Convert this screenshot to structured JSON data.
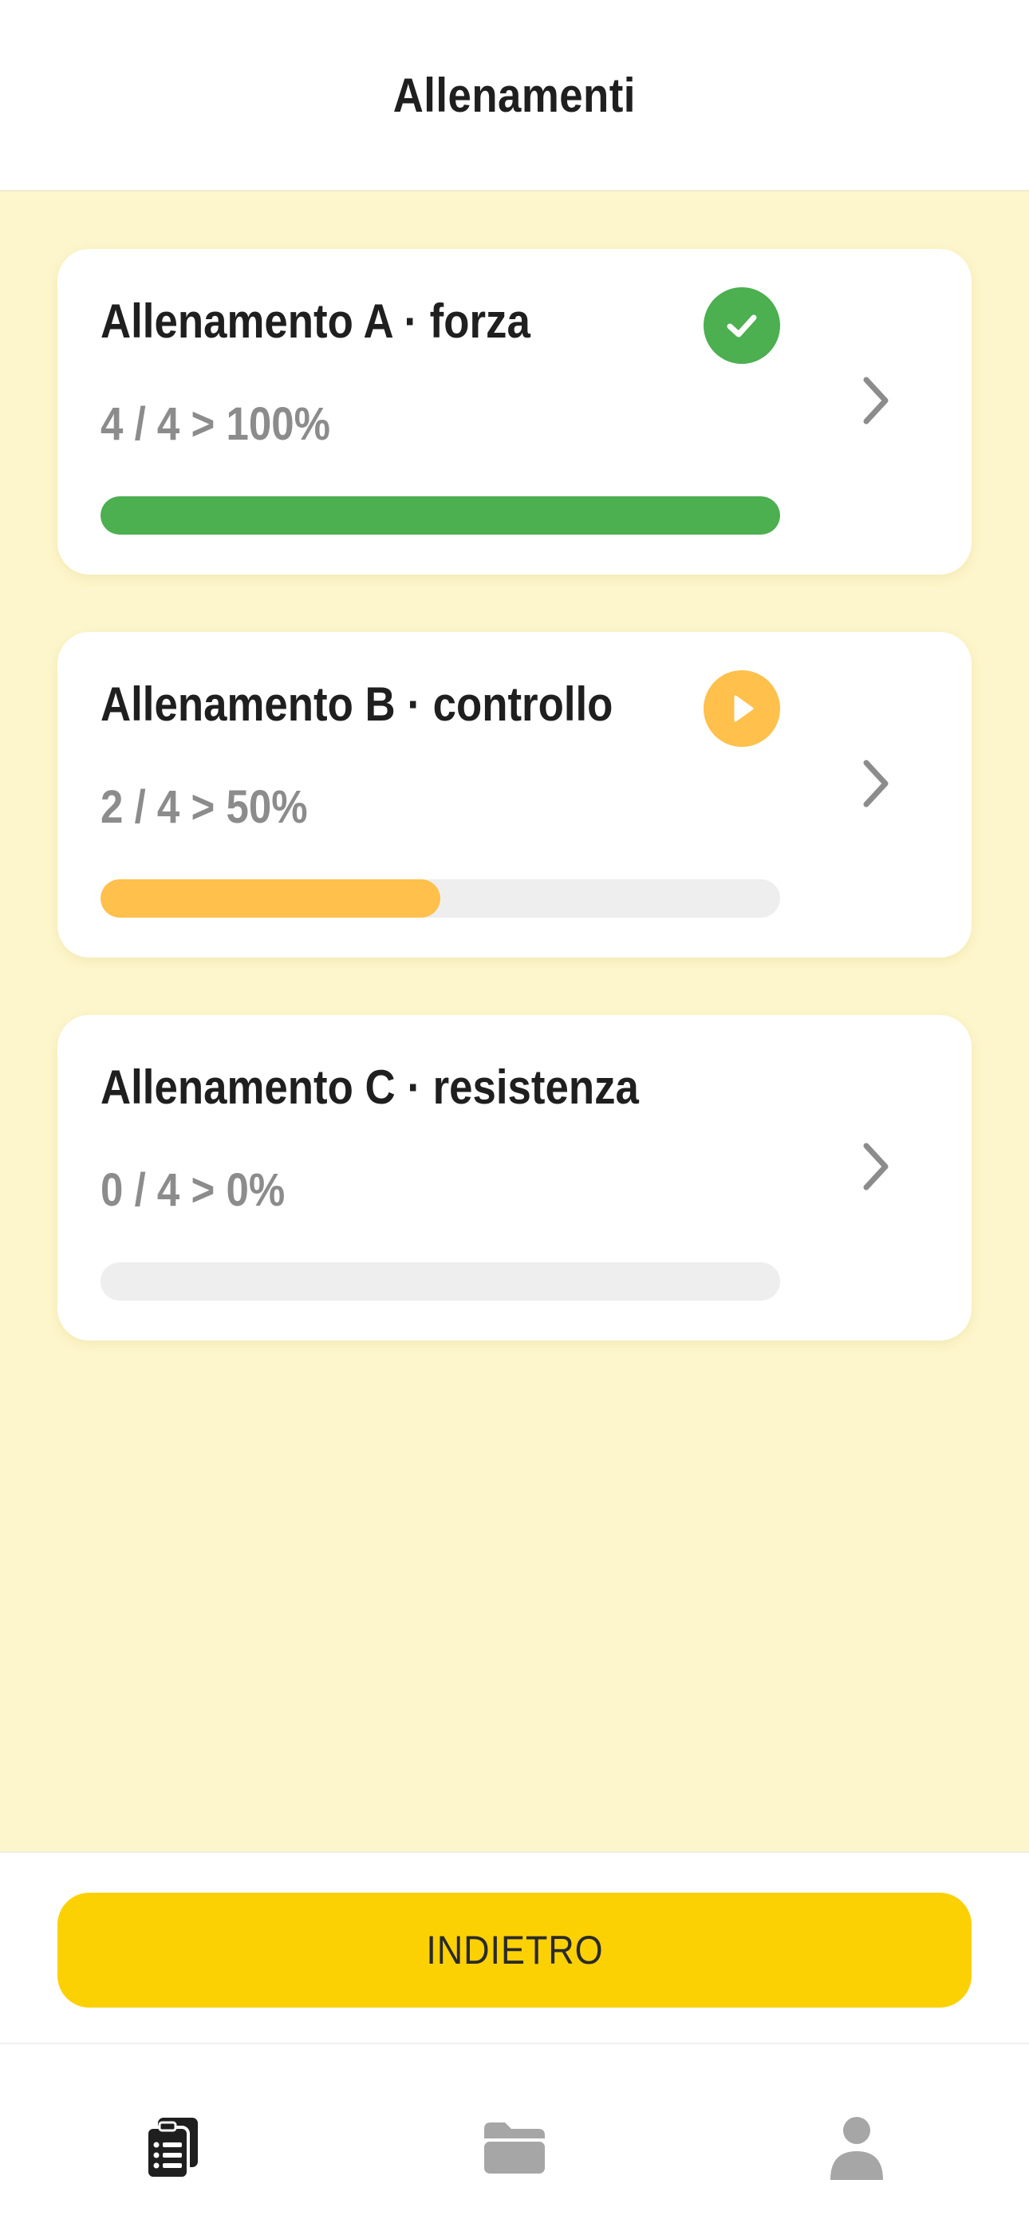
{
  "header": {
    "title": "Allenamenti"
  },
  "workouts": [
    {
      "title": "Allenamento A · forza",
      "progress_text": "4 / 4 > 100%",
      "completed": 4,
      "total": 4,
      "progress_fraction": 1.0,
      "status": "check-icon",
      "bar_color": "#4caf50"
    },
    {
      "title": "Allenamento B · controllo",
      "progress_text": "2 / 4 > 50%",
      "completed": 2,
      "total": 4,
      "progress_fraction": 0.5,
      "status": "play-icon",
      "bar_color": "#ffc04c"
    },
    {
      "title": "Allenamento C · resistenza",
      "progress_text": "0 / 4 > 0%",
      "completed": 0,
      "total": 4,
      "progress_fraction": 0.0,
      "status": "none",
      "bar_color": "#eeeeee"
    }
  ],
  "back_button": {
    "label": "INDIETRO",
    "color": "#fcd104"
  },
  "tabbar": {
    "items": [
      {
        "icon": "clipboard-list-icon",
        "active": true
      },
      {
        "icon": "folder-icon",
        "active": false
      },
      {
        "icon": "user-icon",
        "active": false
      }
    ],
    "active_color": "#1f1f1f",
    "inactive_color": "#a6a6a6"
  },
  "colors": {
    "background": "#fdf6cc",
    "accent": "#fcd104",
    "success": "#4caf50",
    "in_progress": "#ffc04c"
  }
}
